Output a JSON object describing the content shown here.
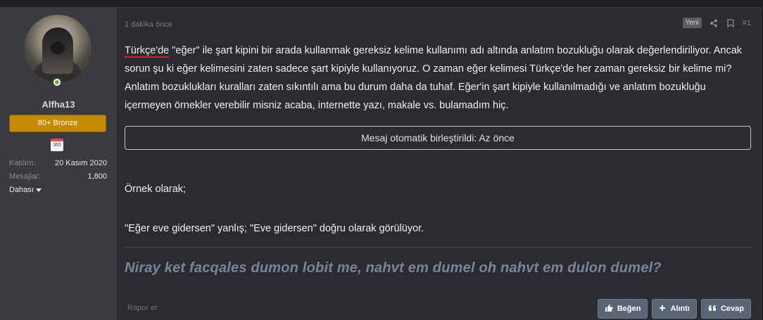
{
  "user": {
    "name": "Alfha13",
    "badge": "80+ Bronze",
    "calendar": "365",
    "joined_label": "Katılım:",
    "joined_value": "20 Kasım 2020",
    "messages_label": "Mesajlar:",
    "messages_value": "1,800",
    "more_label": "Dahası"
  },
  "post": {
    "time": "1 dakika önce",
    "new_badge": "Yeni",
    "number": "#1",
    "underlined_word": "Türkçe'de",
    "paragraph1_rest": " \"eğer\" ile şart kipini bir arada kullanmak gereksiz kelime kullanımı adı altında anlatım bozukluğu olarak değerlendiriliyor. Ancak sorun şu ki eğer kelimesini zaten sadece şart kipiyle kullanıyoruz. O zaman eğer kelimesi Türkçe'de her zaman gereksiz bir kelime mi? Anlatım bozuklukları kuralları zaten sıkıntılı ama bu durum daha da tuhaf. Eğer'in şart kipiyle kullanılmadığı ve anlatım bozukluğu içermeyen örnekler verebilir misniz acaba, internette yazı, makale vs. bulamadım hiç.",
    "merged_notice": "Mesaj otomatik birleştirildi: Az önce",
    "paragraph2": "Örnek olarak;",
    "paragraph3": "\"Eğer eve gidersen\" yanlış; \"Eve gidersen\" doğru olarak görülüyor.",
    "signature": "Niray ket facqales dumon lobit me, nahvt em dumel oh nahvt em dulon dumel?",
    "report": "Rapor et"
  },
  "actions": {
    "like": "Beğen",
    "quote": "Alıntı",
    "reply": "Cevap"
  },
  "icons": [
    "share-icon",
    "bookmark-icon",
    "like-icon",
    "plus-icon",
    "quote-icon",
    "calendar-icon"
  ]
}
